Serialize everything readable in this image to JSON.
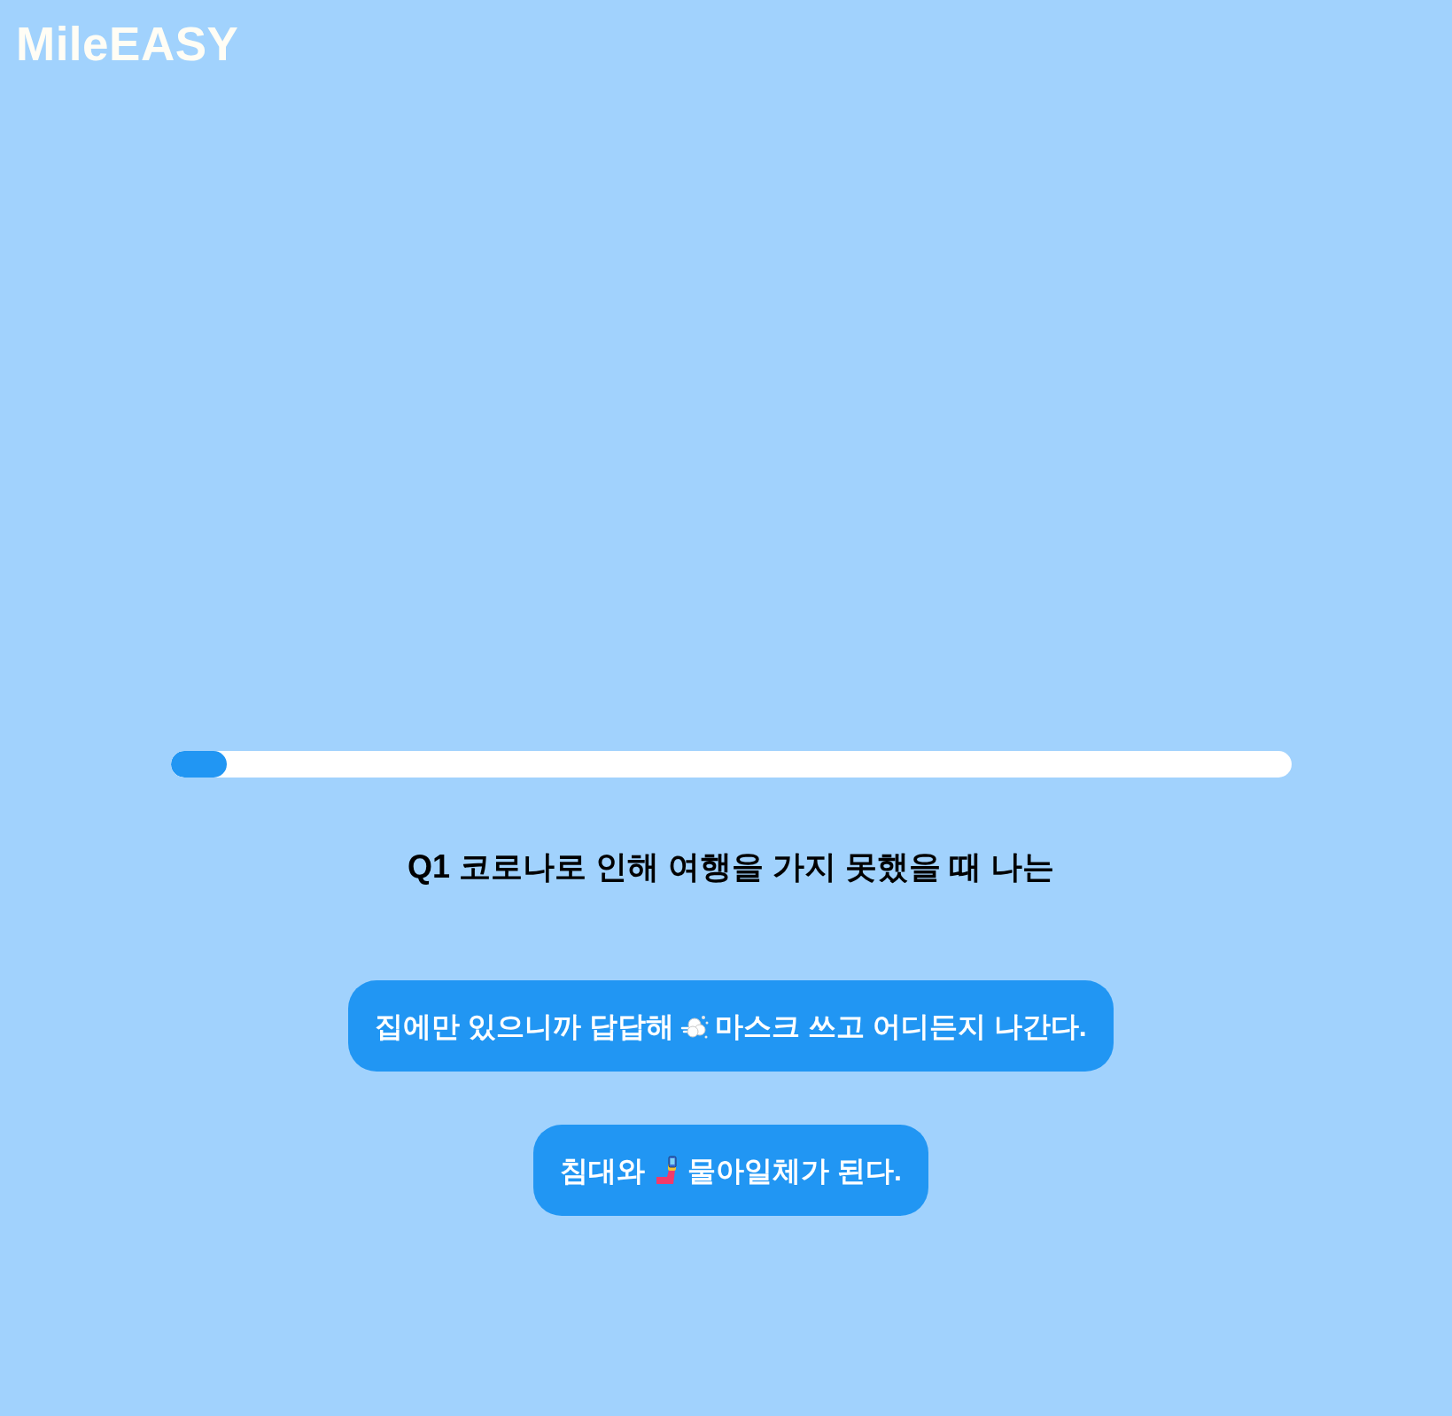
{
  "logo": "MileEASY",
  "progress": {
    "level": 0.05
  },
  "question": "Q1 코로나로 인해 여행을 가지 못했을 때 나는",
  "answers": [
    {
      "parts": [
        "집에만 있으니까 답답해",
        "마스크 쓰고 어디든지 나간다."
      ]
    },
    {
      "parts": [
        "침대와",
        "물아일체가 된다."
      ]
    }
  ]
}
